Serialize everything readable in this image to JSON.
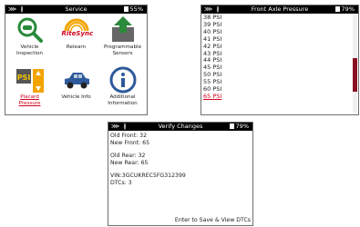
{
  "screen_a": {
    "title": "Service",
    "battery": "55%",
    "status_icons": "⋙ ∦",
    "tiles": [
      {
        "label_1": "Vehicle",
        "label_2": "Inspection",
        "icon": "magnifier-car-icon"
      },
      {
        "label_1": "Relearn",
        "label_2": "",
        "icon": "ritesync-relearn-icon",
        "brand": "RiteSync"
      },
      {
        "label_1": "Programmable",
        "label_2": "Sensors",
        "icon": "program-sensor-icon"
      },
      {
        "label_1": "Placard",
        "label_2": "Pressure",
        "icon": "psi-placard-icon"
      },
      {
        "label_1": "Vehicle Info",
        "label_2": "",
        "icon": "car-icon"
      },
      {
        "label_1": "Additional",
        "label_2": "Information",
        "icon": "info-icon"
      }
    ]
  },
  "screen_b": {
    "title": "Front Axle Pressure",
    "battery": "79%",
    "status_icons": "⋙ ∦",
    "items": [
      "38 PSI",
      "39 PSI",
      "40 PSI",
      "41 PSI",
      "42 PSI",
      "43 PSI",
      "44 PSI",
      "45 PSI",
      "50 PSI",
      "55 PSI",
      "60 PSI",
      "65 PSI"
    ],
    "selected_index": 11,
    "scroll_position": 0.55
  },
  "screen_c": {
    "title": "Verify Changes",
    "battery": "79%",
    "status_icons": "⋙ ∦",
    "old_front": "Old Front: 32",
    "new_front": "New Front: 65",
    "old_rear": "Old Rear: 32",
    "new_rear": "New Rear: 65",
    "vin": "VIN:3GCUKREC5FG312399",
    "dtcs": "DTCs: 3",
    "footer": "Enter to Save & View DTCs"
  }
}
